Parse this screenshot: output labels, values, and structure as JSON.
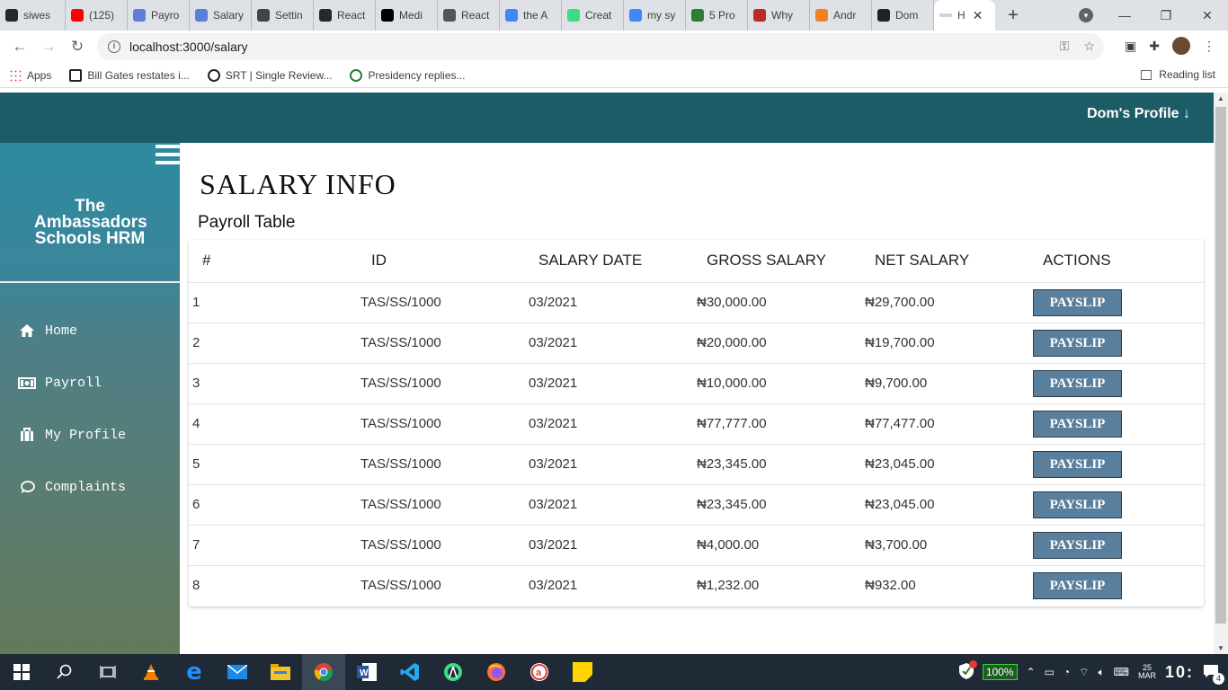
{
  "browser": {
    "tabs": [
      {
        "label": "siwes",
        "color": "#24292e"
      },
      {
        "label": "(125)",
        "color": "#ff0000"
      },
      {
        "label": "Payro",
        "color": "#5b7fd6"
      },
      {
        "label": "Salary",
        "color": "#5b7fd6"
      },
      {
        "label": "Settin",
        "color": "#444444"
      },
      {
        "label": "React",
        "color": "#24292e"
      },
      {
        "label": "Medi",
        "color": "#000000"
      },
      {
        "label": "React",
        "color": "#555555"
      },
      {
        "label": "the A",
        "color": "#4285f4"
      },
      {
        "label": "Creat",
        "color": "#3ddc84"
      },
      {
        "label": "my sy",
        "color": "#4285f4"
      },
      {
        "label": "5 Pro",
        "color": "#2e7d32"
      },
      {
        "label": "Why",
        "color": "#b92b27"
      },
      {
        "label": "Andr",
        "color": "#f48024"
      },
      {
        "label": "Dom",
        "color": "#222222"
      }
    ],
    "active_tab": {
      "label": "H"
    },
    "url": "localhost:3000/salary",
    "bookmarks": [
      {
        "label": "Apps"
      },
      {
        "label": "Bill Gates restates i..."
      },
      {
        "label": "SRT | Single Review..."
      },
      {
        "label": "Presidency replies..."
      }
    ],
    "reading_list": "Reading list"
  },
  "header": {
    "profile_label": "Dom's Profile ↓"
  },
  "sidebar": {
    "brand": "The Ambassadors Schools HRM",
    "items": [
      {
        "label": "Home",
        "icon": "home-icon"
      },
      {
        "label": "Payroll",
        "icon": "money-icon"
      },
      {
        "label": "My Profile",
        "icon": "briefcase-icon"
      },
      {
        "label": "Complaints",
        "icon": "chat-icon"
      }
    ]
  },
  "main": {
    "title": "SALARY INFO",
    "subtitle": "Payroll Table",
    "columns": [
      "#",
      "ID",
      "SALARY DATE",
      "GROSS SALARY",
      "NET SALARY",
      "ACTIONS"
    ],
    "action_label": "PAYSLIP",
    "rows": [
      {
        "num": "1",
        "id": "TAS/SS/1000",
        "date": "03/2021",
        "gross": "₦30,000.00",
        "net": "₦29,700.00"
      },
      {
        "num": "2",
        "id": "TAS/SS/1000",
        "date": "03/2021",
        "gross": "₦20,000.00",
        "net": "₦19,700.00"
      },
      {
        "num": "3",
        "id": "TAS/SS/1000",
        "date": "03/2021",
        "gross": "₦10,000.00",
        "net": "₦9,700.00"
      },
      {
        "num": "4",
        "id": "TAS/SS/1000",
        "date": "03/2021",
        "gross": "₦77,777.00",
        "net": "₦77,477.00"
      },
      {
        "num": "5",
        "id": "TAS/SS/1000",
        "date": "03/2021",
        "gross": "₦23,345.00",
        "net": "₦23,045.00"
      },
      {
        "num": "6",
        "id": "TAS/SS/1000",
        "date": "03/2021",
        "gross": "₦23,345.00",
        "net": "₦23,045.00"
      },
      {
        "num": "7",
        "id": "TAS/SS/1000",
        "date": "03/2021",
        "gross": "₦4,000.00",
        "net": "₦3,700.00"
      },
      {
        "num": "8",
        "id": "TAS/SS/1000",
        "date": "03/2021",
        "gross": "₦1,232.00",
        "net": "₦932.00"
      }
    ]
  },
  "taskbar": {
    "battery": "100%",
    "clock": "10:",
    "date_line1": "25",
    "date_line2": "MAR",
    "notifications": "4"
  },
  "colors": {
    "header": "#1c5c66",
    "button": "#5a7f9c"
  }
}
